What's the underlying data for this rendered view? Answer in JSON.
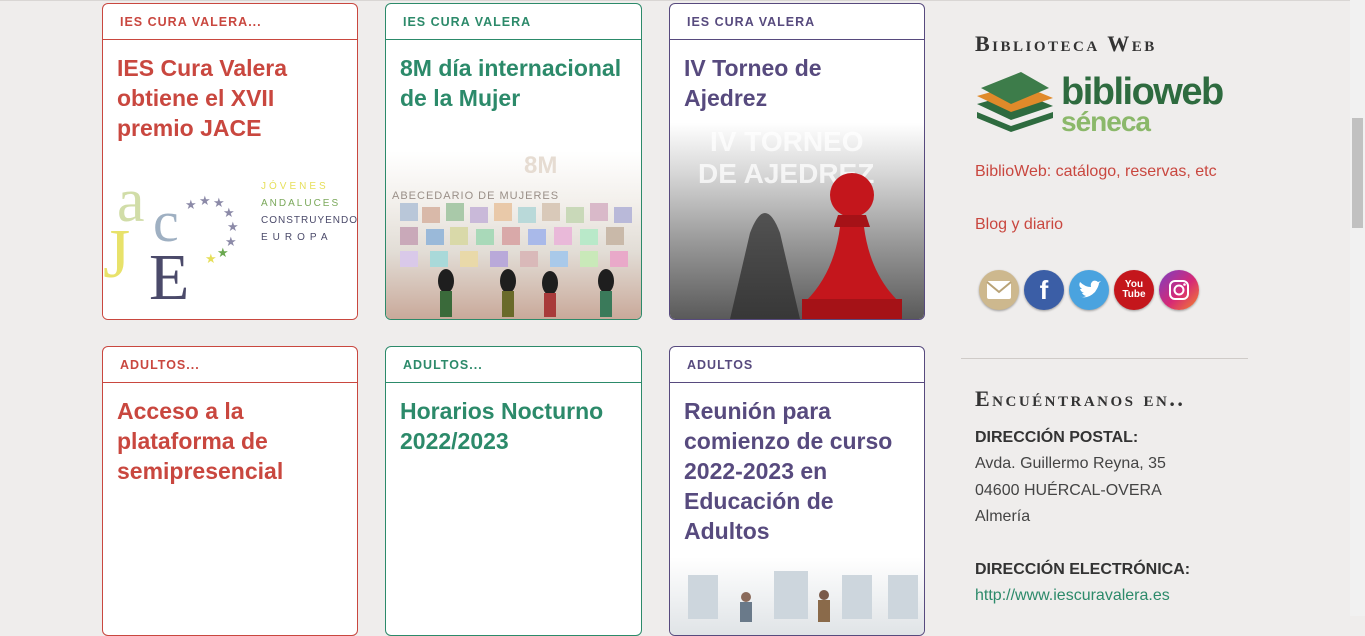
{
  "cards_row1": [
    {
      "category": "IES CURA VALERA...",
      "title": "IES Cura Valera obtiene el XVII premio JACE"
    },
    {
      "category": "IES CURA VALERA",
      "title": "8M día internacional de la Mujer"
    },
    {
      "category": "IES CURA VALERA",
      "title": "IV Torneo de Ajedrez"
    }
  ],
  "cards_row2": [
    {
      "category": "ADULTOS...",
      "title": "Acceso a la plataforma de semipresencial"
    },
    {
      "category": "ADULTOS...",
      "title": "Horarios Nocturno 2022/2023"
    },
    {
      "category": "ADULTOS",
      "title": "Reunión para comienzo de curso 2022-2023 en Educación de Adultos"
    }
  ],
  "jace_logo": {
    "letters": "acJE",
    "tagline": [
      "JÓVENES",
      "ANDALUCES",
      "CONSTRUYENDO",
      "EUROPA"
    ]
  },
  "chess_image_text": [
    "IV TORNEO",
    "DE AJEDREZ"
  ],
  "mujer_image_text": {
    "headline": "8M",
    "sub": "ABECEDARIO DE MUJERES"
  },
  "sidebar": {
    "biblioteca_heading": "Biblioteca Web",
    "biblioweb_logo": {
      "main": "biblioweb",
      "sub": "séneca"
    },
    "biblioweb_link": "BiblioWeb: catálogo, reservas, etc",
    "blog_link": "Blog y diario",
    "social_icons": [
      "mail-icon",
      "facebook-icon",
      "twitter-icon",
      "youtube-icon",
      "instagram-icon"
    ],
    "find_heading": "Encuéntranos en..",
    "postal_label": "DIRECCIÓN POSTAL:",
    "postal_lines": [
      "Avda. Guillermo Reyna, 35",
      "04600 HUÉRCAL-OVERA",
      "Almería"
    ],
    "email_label": "DIRECCIÓN ELECTRÓNICA:",
    "web_link": "http://www.iescuravalera.es"
  },
  "colors": {
    "red": "#c9473f",
    "green": "#2c8a6a",
    "purple": "#574a7e",
    "background": "#efedec"
  }
}
